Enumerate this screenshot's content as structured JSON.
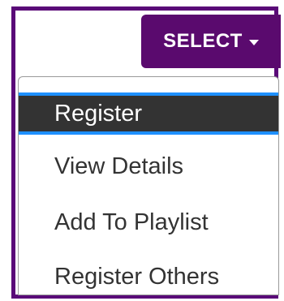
{
  "select_button": {
    "label": "SELECT"
  },
  "menu": {
    "items": [
      {
        "label": "Register",
        "active": true
      },
      {
        "label": "View Details",
        "active": false
      },
      {
        "label": "Add To Playlist",
        "active": false
      },
      {
        "label": "Register Others",
        "active": false
      }
    ]
  },
  "colors": {
    "frame_border": "#5a0a78",
    "button_bg": "#5a0a6e",
    "active_bg": "#333333",
    "active_border": "#1e90ff",
    "item_text": "#333333"
  },
  "icons": {
    "caret": "caret-down-icon"
  }
}
